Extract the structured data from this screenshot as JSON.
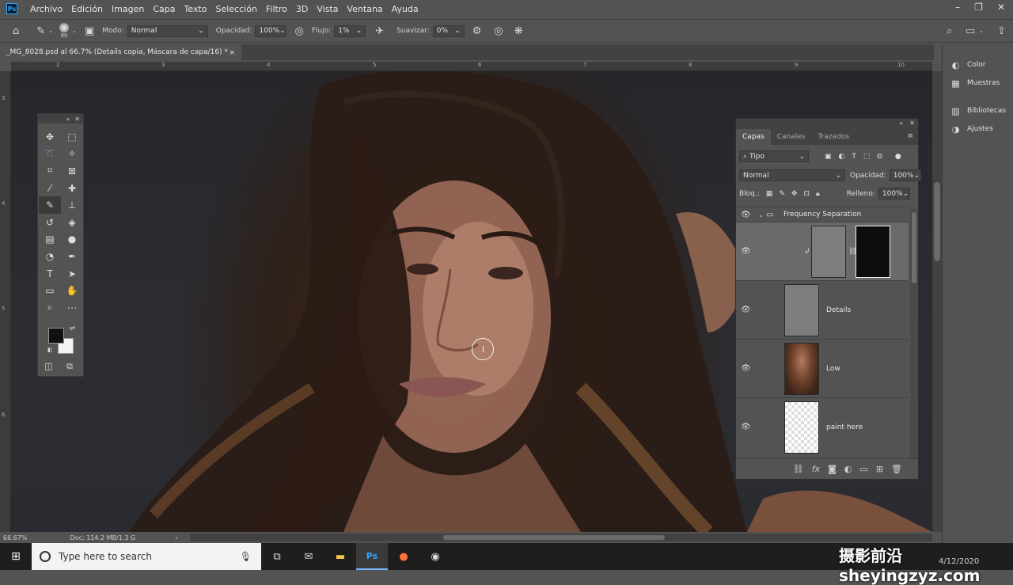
{
  "app": {
    "logo": "Ps",
    "menu": [
      "Archivo",
      "Edición",
      "Imagen",
      "Capa",
      "Texto",
      "Selección",
      "Filtro",
      "3D",
      "Vista",
      "Ventana",
      "Ayuda"
    ],
    "window_controls": [
      "–",
      "❐",
      "✕"
    ]
  },
  "options_bar": {
    "brush_size": "80",
    "mode_label": "Modo:",
    "mode_value": "Normal",
    "opacity_label": "Opacidad:",
    "opacity_value": "100%",
    "flow_label": "Flujo:",
    "flow_value": "1%",
    "smoothing_label": "Suavizar:",
    "smoothing_value": "0%"
  },
  "document": {
    "tab_title": "_MG_8028.psd al 66.7% (Details copia, Máscara de capa/16) *",
    "tab_close": "✕",
    "zoom": "66.67%",
    "doc_info": "Doc: 114.2 MB/1.3 G"
  },
  "rulers": {
    "top": [
      "2",
      "3",
      "4",
      "5",
      "6",
      "7",
      "8",
      "9",
      "10"
    ],
    "left": [
      "3",
      "4",
      "5",
      "6"
    ]
  },
  "dock": {
    "items": [
      {
        "label": "Color",
        "icon": "color-icon"
      },
      {
        "label": "Muestras",
        "icon": "swatches-icon"
      },
      {
        "label": "Bibliotecas",
        "icon": "libraries-icon"
      },
      {
        "label": "Ajustes",
        "icon": "adjustments-icon"
      }
    ]
  },
  "layers_panel": {
    "tabs": [
      "Capas",
      "Canales",
      "Trazados"
    ],
    "active_tab": "Capas",
    "filter_value": "Tipo",
    "blend_mode": "Normal",
    "opacity_label": "Opacidad:",
    "opacity_value": "100%",
    "lock_label": "Bloq.:",
    "fill_label": "Relleno:",
    "fill_value": "100%",
    "group_name": "Frequency Separation",
    "layers": [
      {
        "name": "",
        "selected": true,
        "thumb": "gray",
        "mask": true
      },
      {
        "name": "Details",
        "selected": false,
        "thumb": "gray"
      },
      {
        "name": "Low",
        "selected": false,
        "thumb": "photo"
      },
      {
        "name": "paint here",
        "selected": false,
        "thumb": "transparent"
      }
    ]
  },
  "taskbar": {
    "search_placeholder": "Type here to search",
    "clock": "4/12/2020"
  },
  "watermark": "摄影前沿 sheyingzyz.com",
  "colors": {
    "panel_bg": "#535353",
    "foreground_swatch": "#111111",
    "background_swatch": "#f2f2f2",
    "accent": "#31a8ff"
  }
}
